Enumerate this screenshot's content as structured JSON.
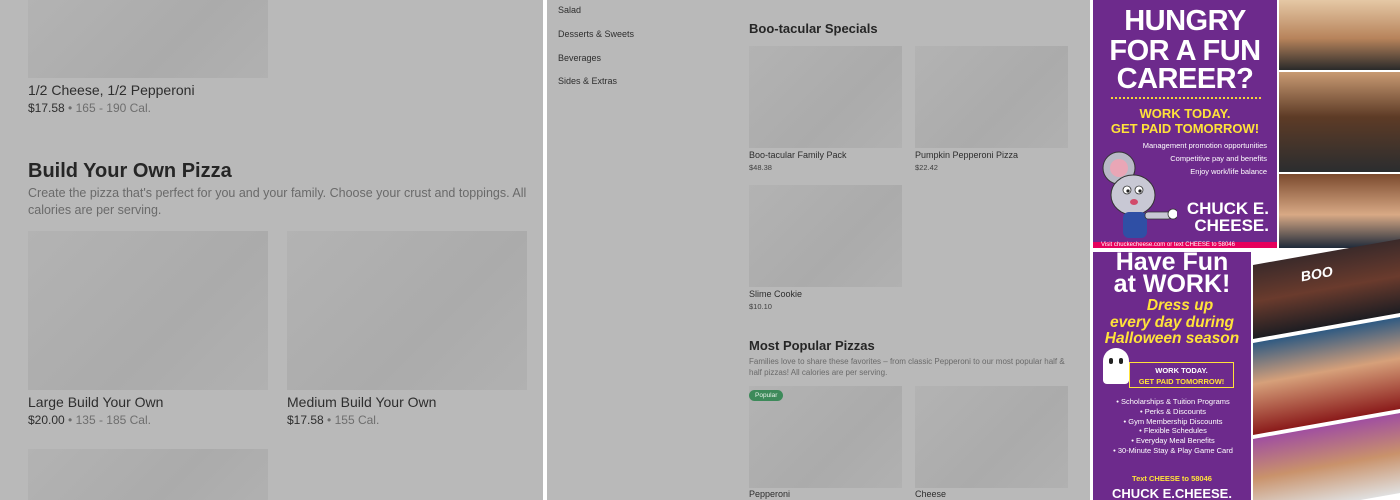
{
  "left": {
    "top_item": {
      "name": "1/2 Cheese, 1/2 Pepperoni",
      "price": "$17.58",
      "cal": "165 - 190 Cal."
    },
    "section": {
      "title": "Build Your Own Pizza",
      "description": "Create the pizza that's perfect for you and your family. Choose your crust and toppings. All calories are per serving."
    },
    "items": [
      {
        "name": "Large Build Your Own",
        "price": "$20.00",
        "cal": "135 - 185 Cal."
      },
      {
        "name": "Medium Build Your Own",
        "price": "$17.58",
        "cal": "155 Cal."
      }
    ],
    "separator": "•"
  },
  "middle": {
    "nav": [
      "Salad",
      "Desserts & Sweets",
      "Beverages",
      "Sides & Extras"
    ],
    "specials": {
      "title": "Boo-tacular Specials",
      "items": [
        {
          "name": "Boo-tacular Family Pack",
          "price": "$48.38"
        },
        {
          "name": "Pumpkin Pepperoni Pizza",
          "price": "$22.42"
        },
        {
          "name": "Slime Cookie",
          "price": "$10.10"
        }
      ]
    },
    "popular": {
      "title": "Most Popular Pizzas",
      "description": "Families love to share these favorites – from classic Pepperoni to our most popular half & half pizzas! All calories are per serving.",
      "badge": "Popular",
      "items": [
        {
          "name": "Pepperoni"
        },
        {
          "name": "Cheese"
        }
      ]
    }
  },
  "ad": {
    "top": {
      "headline": [
        "HUNGRY",
        "FOR A FUN",
        "CAREER?"
      ],
      "yellow1": "WORK TODAY.",
      "yellow2": "GET PAID TOMORROW!",
      "bullets": [
        "Management promotion opportunities",
        "Competitive pay and benefits",
        "Enjoy work/life balance"
      ],
      "brand1": "CHUCK E.",
      "brand2": "CHEESE.",
      "visit": "Visit chuckecheese.com or text CHEESE to 58046"
    },
    "bottom": {
      "headline1": "Have Fun",
      "headline2": "at WORK!",
      "italic1": "Dress up",
      "italic2": "every day during",
      "italic3": "Halloween season",
      "box1": "WORK TODAY.",
      "box2": "GET PAID TOMORROW!",
      "list": [
        "• Scholarships & Tuition Programs",
        "• Perks & Discounts",
        "• Gym Membership Discounts",
        "• Flexible Schedules",
        "• Everyday Meal Benefits",
        "• 30-Minute Stay & Play Game Card"
      ],
      "text_cta": "Text CHEESE to 58046",
      "brand": "CHUCK E.CHEESE.",
      "photo_sign": "BOO"
    },
    "colors": {
      "purple": "#6d2a8c",
      "yellow": "#ffe23a",
      "pink": "#e6005c"
    }
  }
}
